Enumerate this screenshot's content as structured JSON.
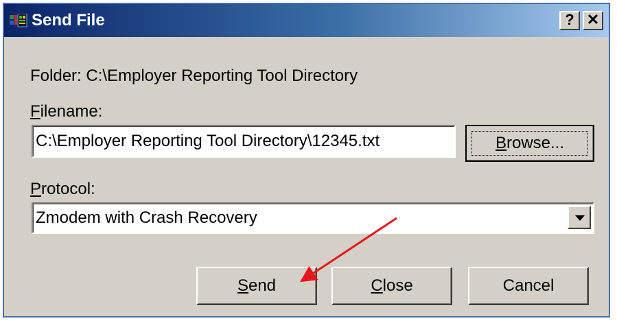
{
  "window": {
    "title": "Send File",
    "help_label": "?",
    "close_label": "✕"
  },
  "folder": {
    "label": "Folder:",
    "path": "C:\\Employer Reporting Tool Directory"
  },
  "filename": {
    "label_first": "F",
    "label_rest": "ilename:",
    "value": "C:\\Employer Reporting Tool Directory\\12345.txt",
    "browse_first": "B",
    "browse_rest": "rowse..."
  },
  "protocol": {
    "label_first": "P",
    "label_rest": "rotocol:",
    "selected": "Zmodem with Crash Recovery"
  },
  "buttons": {
    "send_first": "S",
    "send_rest": "end",
    "close_first": "C",
    "close_rest": "lose",
    "cancel": "Cancel"
  },
  "colors": {
    "annotation_arrow": "#e8141b"
  }
}
